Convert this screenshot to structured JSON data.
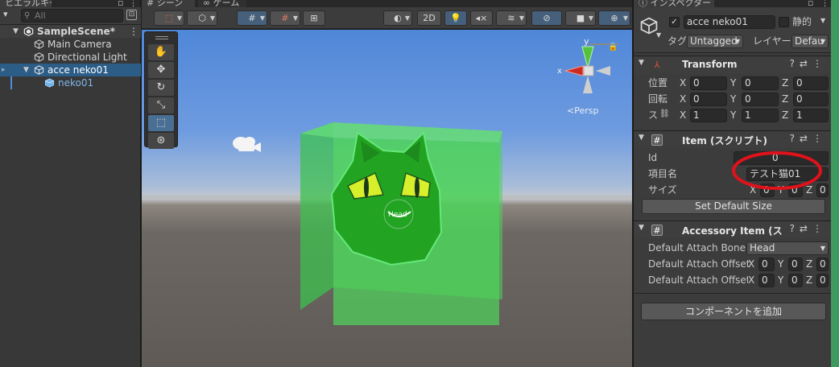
{
  "hierarchy": {
    "tab_label": "ヒエラルキー",
    "search_placeholder": "All",
    "items": [
      {
        "label": "SampleScene*"
      },
      {
        "label": "Main Camera"
      },
      {
        "label": "Directional Light"
      },
      {
        "label": "acce neko01"
      },
      {
        "label": "neko01"
      }
    ]
  },
  "scene": {
    "tabs": [
      {
        "label": "シーン"
      },
      {
        "label": "ゲーム"
      }
    ],
    "toolbar": {
      "mode_2d": "2D"
    },
    "gizmo": {
      "persp_label": "<Persp",
      "axis_x": "x",
      "axis_y": "y"
    },
    "object_label": "Head"
  },
  "inspector": {
    "tab_label": "インスペクター",
    "object_name": "acce neko01",
    "static_label": "静的",
    "tag_label": "タグ",
    "tag_value": "Untagged",
    "layer_label": "レイヤー",
    "layer_value": "Defau",
    "transform": {
      "title": "Transform",
      "rows": [
        {
          "label": "位置",
          "x": "0",
          "y": "0",
          "z": "0"
        },
        {
          "label": "回転",
          "x": "0",
          "y": "0",
          "z": "0"
        },
        {
          "label": "ス",
          "x": "1",
          "y": "1",
          "z": "1"
        }
      ]
    },
    "item": {
      "title": "Item (スクリプト)",
      "id_label": "Id",
      "id_value": "0",
      "name_label": "項目名",
      "name_value": "テスト猫01",
      "size_label": "サイズ",
      "size_x": "0",
      "size_y": "0",
      "size_z": "0",
      "button": "Set Default Size"
    },
    "accessory": {
      "title": "Accessory Item (ス",
      "bone_label": "Default Attach Bone I",
      "bone_value": "Head",
      "offset_label": "Default Attach Offset",
      "offset_x": "0",
      "offset_y": "0",
      "offset_z": "0",
      "rot_label": "Default Attach Offset R",
      "rot_x": "0",
      "rot_y": "0",
      "rot_z": "0"
    },
    "add_component": "コンポーネントを追加"
  },
  "colors": {
    "selection": "#2c5d87",
    "cube_green": "#4fd15b",
    "cat_green": "#22a322",
    "eye_yellow": "#d7f02b",
    "highlight_red": "#e0121b"
  }
}
